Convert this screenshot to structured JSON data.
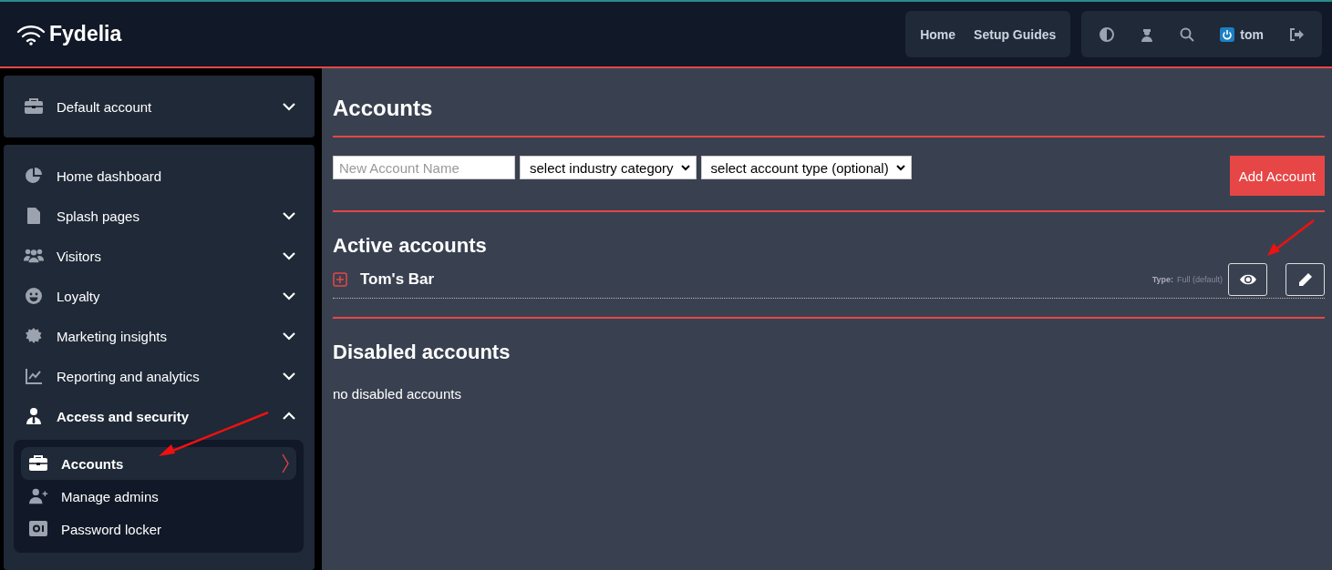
{
  "header": {
    "brand": "Fydelia",
    "nav": [
      {
        "label": "Home"
      },
      {
        "label": "Setup Guides"
      }
    ],
    "tools": [
      {
        "kind": "contrast"
      },
      {
        "kind": "admin"
      },
      {
        "kind": "search"
      },
      {
        "kind": "user",
        "label": "tom"
      },
      {
        "kind": "logout"
      }
    ]
  },
  "sidebar": {
    "account_switcher": {
      "label": "Default account"
    },
    "items": [
      {
        "label": "Home dashboard",
        "kind": "link"
      },
      {
        "label": "Splash pages",
        "kind": "group",
        "expanded": false
      },
      {
        "label": "Visitors",
        "kind": "group",
        "expanded": false
      },
      {
        "label": "Loyalty",
        "kind": "group",
        "expanded": false
      },
      {
        "label": "Marketing insights",
        "kind": "group",
        "expanded": false
      },
      {
        "label": "Reporting and analytics",
        "kind": "group",
        "expanded": false
      },
      {
        "label": "Access and security",
        "kind": "group",
        "expanded": true,
        "children": [
          {
            "label": "Accounts",
            "selected": true
          },
          {
            "label": "Manage admins",
            "selected": false
          },
          {
            "label": "Password locker",
            "selected": false
          }
        ]
      }
    ]
  },
  "main": {
    "title": "Accounts",
    "form": {
      "name_field": {
        "placeholder": "New Account Name"
      },
      "selects": [
        {
          "value": "select industry category"
        },
        {
          "value": "select account type (optional)"
        }
      ],
      "submit": "Add Account"
    },
    "active_title": "Active accounts",
    "active_accounts": [
      {
        "name": "Tom's Bar",
        "type_label": "Type:",
        "type_value": "Full (default)"
      }
    ],
    "disabled_title": "Disabled accounts",
    "disabled_empty": "no disabled accounts"
  }
}
